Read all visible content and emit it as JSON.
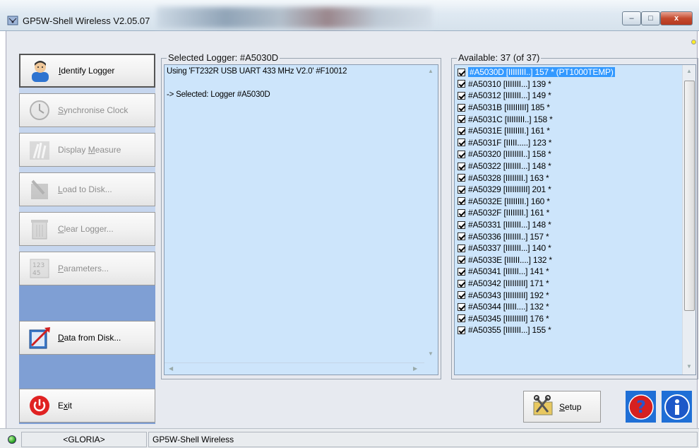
{
  "window": {
    "title": "GP5W-Shell Wireless V2.05.07",
    "controls": {
      "minimize": "–",
      "maximize": "□",
      "close": "x"
    }
  },
  "sidebar": {
    "buttons": [
      {
        "label_prefix": "",
        "underline": "I",
        "label_rest": "dentify Logger",
        "icon": "person-icon",
        "enabled": true
      },
      {
        "label_prefix": "",
        "underline": "S",
        "label_rest": "ynchronise Clock",
        "icon": "clock-icon",
        "enabled": false
      },
      {
        "label_prefix": "Display ",
        "underline": "M",
        "label_rest": "easure",
        "icon": "signal-icon",
        "enabled": false
      },
      {
        "label_prefix": "",
        "underline": "L",
        "label_rest": "oad to Disk...",
        "icon": "load-disk-icon",
        "enabled": false
      },
      {
        "label_prefix": "",
        "underline": "C",
        "label_rest": "lear Logger...",
        "icon": "trash-icon",
        "enabled": false
      },
      {
        "label_prefix": "",
        "underline": "P",
        "label_rest": "arameters...",
        "icon": "parameters-icon",
        "enabled": false
      },
      {
        "label_prefix": "",
        "underline": "D",
        "label_rest": "ata from Disk...",
        "icon": "data-chart-icon",
        "enabled": true
      },
      {
        "label_prefix": "E",
        "underline": "x",
        "label_rest": "it",
        "icon": "power-icon",
        "enabled": true
      }
    ]
  },
  "selected_logger": {
    "group_title": "Selected Logger: #A5030D",
    "log_lines": [
      "Using 'FT232R USB UART 433 MHz V2.0' #F10012",
      "",
      "-> Selected: Logger #A5030D"
    ]
  },
  "available": {
    "group_title": "Available: 37 (of 37)",
    "items": [
      "#A5030D [IIIIIIII..] 157 * (PT1000TEMP)",
      "#A50310 [IIIIIII...] 139 *",
      "#A50312 [IIIIIII...] 149 *",
      "#A5031B [IIIIIIIII] 185 *",
      "#A5031C [IIIIIIII..] 158 *",
      "#A5031E [IIIIIIII.] 161 *",
      "#A5031F [IIIII.....] 123 *",
      "#A50320 [IIIIIIII..] 158 *",
      "#A50322 [IIIIIII...] 148 *",
      "#A50328 [IIIIIIII.] 163 *",
      "#A50329 [IIIIIIIIII] 201 *",
      "#A5032E [IIIIIIII.] 160 *",
      "#A5032F [IIIIIIII.] 161 *",
      "#A50331 [IIIIIII...] 148 *",
      "#A50336 [IIIIIII..] 157 *",
      "#A50337 [IIIIIII...] 140 *",
      "#A5033E [IIIIII....] 132 *",
      "#A50341 [IIIIII...] 141 *",
      "#A50342 [IIIIIIIII] 171 *",
      "#A50343 [IIIIIIIII] 192 *",
      "#A50344 [IIIII....] 132 *",
      "#A50345 [IIIIIIIII] 176 *",
      "#A50355 [IIIIIII...] 155 *"
    ],
    "selected_index": 0
  },
  "bottom": {
    "setup_underline": "S",
    "setup_rest": "etup",
    "help_icon": "help-question-icon",
    "info_icon": "info-icon"
  },
  "status": {
    "user": "<GLORIA>",
    "app": "GP5W-Shell Wireless"
  },
  "colors": {
    "panel_blue": "#7f9fd4",
    "list_bg": "#cde5fb",
    "selection": "#3399ff"
  }
}
